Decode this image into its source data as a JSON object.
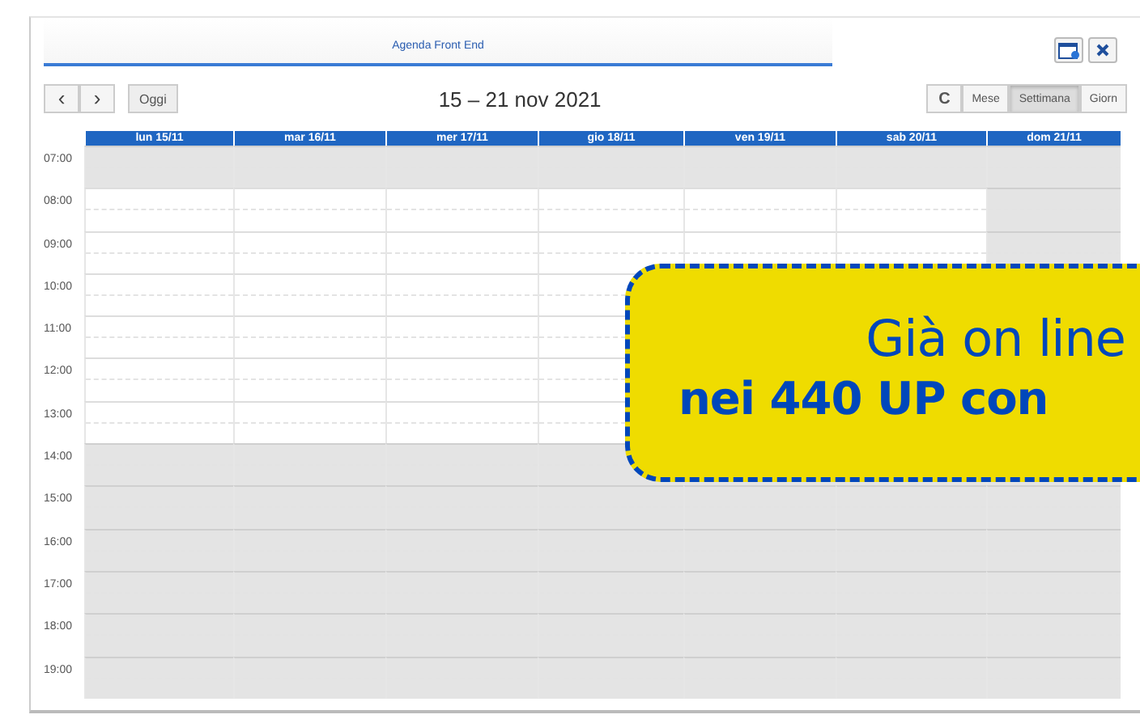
{
  "window": {
    "title": "Agenda Front End"
  },
  "toolbar": {
    "prev": "‹",
    "next": "›",
    "today": "Oggi",
    "range": "15 – 21 nov 2021",
    "refresh": "C",
    "views": [
      {
        "label": "Mese",
        "selected": false
      },
      {
        "label": "Settimana",
        "selected": true
      },
      {
        "label": "Giorn",
        "selected": false
      }
    ]
  },
  "days": [
    {
      "label": "lun 15/11",
      "closed": false
    },
    {
      "label": "mar 16/11",
      "closed": false
    },
    {
      "label": "mer 17/11",
      "closed": false
    },
    {
      "label": "gio 18/11",
      "closed": false
    },
    {
      "label": "ven 19/11",
      "closed": false
    },
    {
      "label": "sab 20/11",
      "closed": false
    },
    {
      "label": "dom 21/11",
      "closed": true
    }
  ],
  "hours": [
    {
      "time": "07:00",
      "closed": true
    },
    {
      "time": "08:00",
      "closed": false
    },
    {
      "time": "09:00",
      "closed": false
    },
    {
      "time": "10:00",
      "closed": false
    },
    {
      "time": "11:00",
      "closed": false
    },
    {
      "time": "12:00",
      "closed": false
    },
    {
      "time": "13:00",
      "closed": false
    },
    {
      "time": "14:00",
      "closed": true
    },
    {
      "time": "15:00",
      "closed": true
    },
    {
      "time": "16:00",
      "closed": true
    },
    {
      "time": "17:00",
      "closed": true
    },
    {
      "time": "18:00",
      "closed": true
    },
    {
      "time": "19:00",
      "closed": true
    }
  ],
  "callout": {
    "line1": "Già on line",
    "line2": "nei 440 UP con"
  }
}
